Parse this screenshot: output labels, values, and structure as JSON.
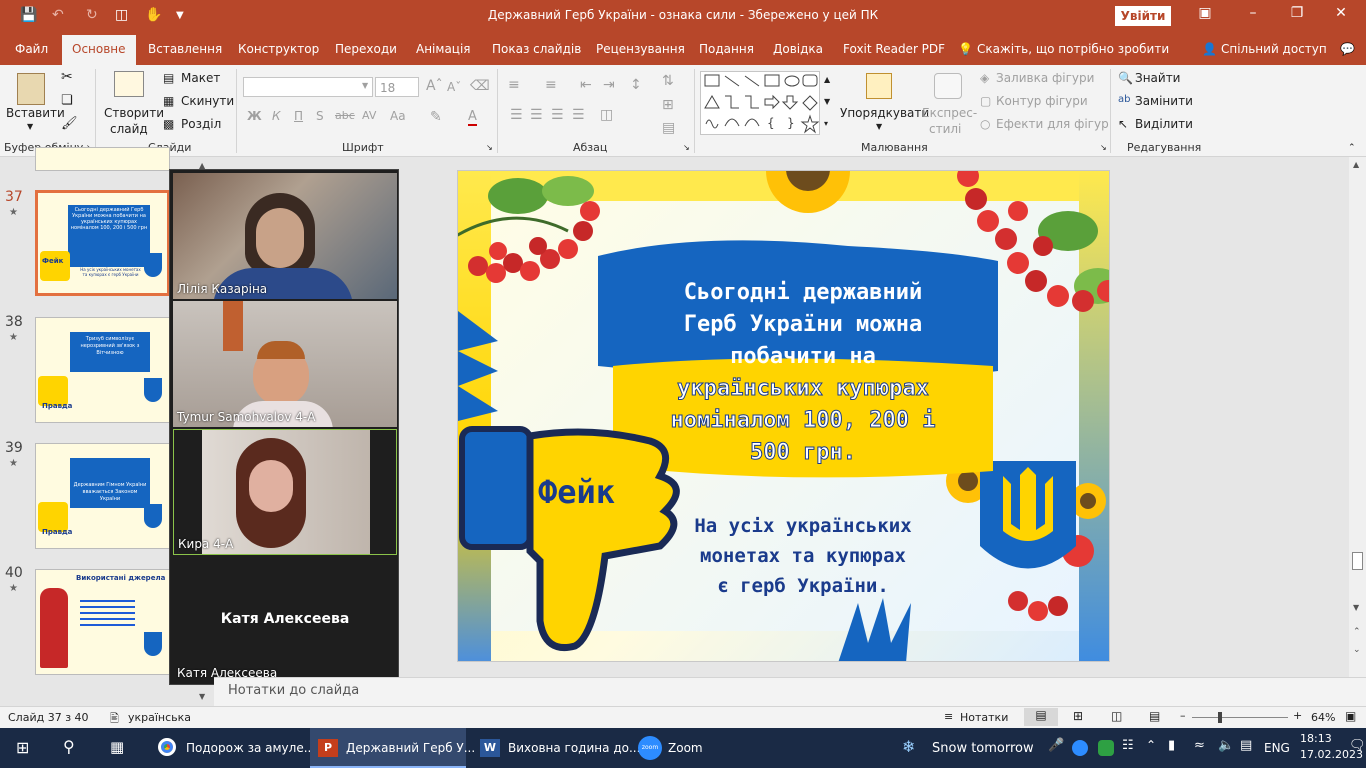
{
  "window": {
    "title": "Державний Герб України - ознака сили  -  Збережено у цей ПК",
    "signin_label": "Увійти"
  },
  "tabs": [
    "Файл",
    "Основне",
    "Вставлення",
    "Конструктор",
    "Переходи",
    "Анімація",
    "Показ слайдів",
    "Рецензування",
    "Подання",
    "Довідка",
    "Foxit Reader PDF"
  ],
  "tell_me": "Скажіть, що потрібно зробити",
  "share_label": "Спільний доступ",
  "ribbon": {
    "clipboard": {
      "paste": "Вставити",
      "group": "Буфер обміну"
    },
    "slides": {
      "new_slide": "Створити",
      "new_slide2": "слайд",
      "layout": "Макет",
      "reset": "Скинути",
      "section": "Розділ",
      "group": "Слайди"
    },
    "font": {
      "size": "18",
      "group": "Шрифт",
      "bold": "Ж",
      "italic": "К",
      "underline": "П",
      "strike": "S",
      "abc": "abc",
      "spacing": "AV",
      "case": "Aa",
      "color": "A"
    },
    "paragraph": {
      "group": "Абзац"
    },
    "drawing": {
      "arrange": "Упорядкувати",
      "quick_styles": "Експрес-",
      "quick_styles2": "стилі",
      "fill": "Заливка фігури",
      "outline": "Контур фігури",
      "effects": "Ефекти для фігур",
      "group": "Малювання"
    },
    "editing": {
      "find": "Знайти",
      "replace": "Замінити",
      "select": "Виділити",
      "group": "Редагування"
    }
  },
  "thumbnails": [
    {
      "num": "37",
      "selected": true,
      "badge": "Фейк",
      "text": "Сьогодні державний Герб України можна побачити на українських купюрах номіналом 100, 200 і 500 грн",
      "sub": "На усіх українських монетах та купюрах є герб України"
    },
    {
      "num": "38",
      "selected": false,
      "badge": "Правда",
      "text": "Тризуб символізує нерозривний зв'язок з Вітчизною",
      "sub": ""
    },
    {
      "num": "39",
      "selected": false,
      "badge": "Правда",
      "text": "Державним Гімном України вважається Законом України",
      "sub": ""
    },
    {
      "num": "40",
      "selected": false,
      "badge": "",
      "text": "Використані джерела",
      "sub": ""
    }
  ],
  "zoom": {
    "participants": [
      {
        "name": "Лілія Казаріна",
        "video": true
      },
      {
        "name": "Tymur Samohvalov 4-А",
        "video": true
      },
      {
        "name": "Кира 4-А",
        "video": true
      },
      {
        "name": "Катя Алексеева",
        "video": false,
        "display": "Катя Алексеева"
      }
    ]
  },
  "slide": {
    "main_text_lines": [
      "Сьогодні державний",
      "Герб України можна",
      "побачити на",
      "українських  купюрах",
      "номіналом  100, 200 і",
      "500 грн."
    ],
    "badge": "Фейк",
    "answer_lines": [
      "На усіх  українських",
      "монетах та купюрах",
      "є герб України."
    ],
    "colors": {
      "blue": "#1565c0",
      "yellow": "#ffd400",
      "text": "#1a3b8c"
    }
  },
  "notes_placeholder": "Нотатки до слайда",
  "status": {
    "slide_counter": "Слайд 37 з 40",
    "language": "українська",
    "notes_btn": "Нотатки",
    "zoom": "64%"
  },
  "taskbar": {
    "apps": [
      "Подорож за амуле...",
      "Державний Герб У...",
      "Виховна година до...",
      "Zoom"
    ],
    "weather": "Snow tomorrow",
    "lang": "ENG",
    "time": "18:13",
    "date": "17.02.2023"
  }
}
